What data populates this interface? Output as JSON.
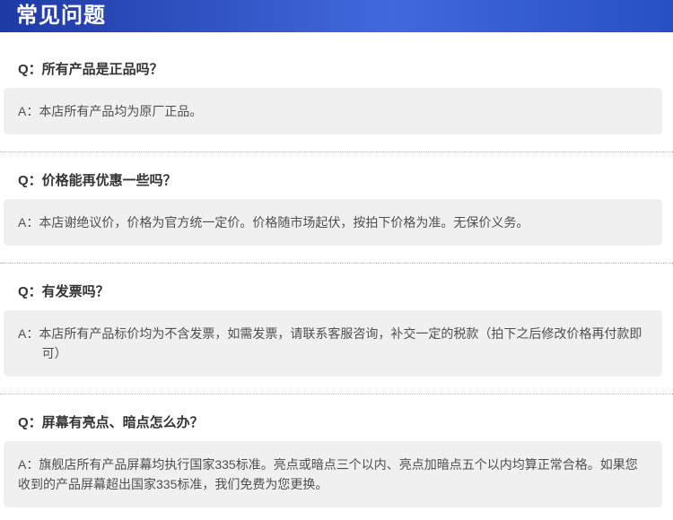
{
  "header": {
    "title": "常见问题"
  },
  "colors": {
    "grad_left": "#1e3aa5",
    "grad_mid": "#4169dd",
    "grad_right": "#2750c3",
    "header_text": "#ffffff",
    "q_text": "#333333",
    "a_text": "#4f4f4f",
    "a_bg": "#f0f0f0",
    "divider": "#bbbbbb",
    "page_bg": "#ffffff"
  },
  "faq": {
    "items": [
      {
        "question": "Q：所有产品是正品吗？",
        "answer": "A：本店所有产品均为原厂正品。"
      },
      {
        "question": "Q：价格能再优惠一些吗？",
        "answer": "A：本店谢绝议价，价格为官方统一定价。价格随市场起伏，按拍下价格为准。无保价义务。"
      },
      {
        "question": "Q：有发票吗？",
        "answer": "A：本店所有产品标价均为不含发票，如需发票，请联系客服咨询，补交一定的税款（拍下之后修改价格再付款即可）"
      },
      {
        "question": "Q：屏幕有亮点、暗点怎么办？",
        "answer": "A：旗舰店所有产品屏幕均执行国家335标准。亮点或暗点三个以内、亮点加暗点五个以内均算正常合格。如果您收到的产品屏幕超出国家335标准，我们免费为您更换。"
      }
    ]
  }
}
